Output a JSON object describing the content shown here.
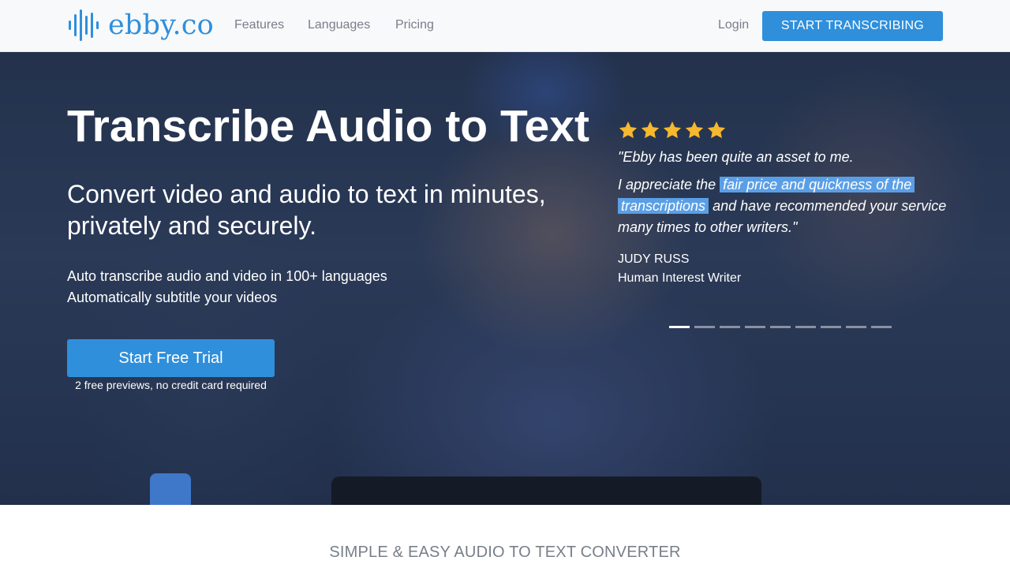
{
  "nav": {
    "logo_text": "ebby.co",
    "links": [
      "Features",
      "Languages",
      "Pricing"
    ],
    "login": "Login",
    "cta": "START TRANSCRIBING"
  },
  "hero": {
    "title": "Transcribe Audio to Text",
    "subtitle": "Convert video and audio to text in minutes, privately and securely.",
    "features": [
      "Auto transcribe audio and video in 100+ languages",
      "Automatically subtitle your videos"
    ],
    "cta": "Start Free Trial",
    "cta_note": "2 free previews, no credit card required"
  },
  "testimonial": {
    "rating": 5,
    "quote": {
      "line1": "\"Ebby has been quite an asset to me.",
      "line2_pre": "I appreciate the",
      "line2_highlight": "fair price and quickness of the",
      "line3_highlight": "transcriptions",
      "line3_post": "and have recommended your service",
      "line4": "many times to other writers.\""
    },
    "author": "JUDY RUSS",
    "role": "Human Interest Writer",
    "carousel_count": 9,
    "carousel_active": 1
  },
  "section": {
    "heading": "SIMPLE & EASY AUDIO TO TEXT CONVERTER"
  },
  "colors": {
    "brand": "#2f8fdb",
    "highlight": "#5a9fe6",
    "star": "#f5b82e",
    "nav_text": "#777f88"
  }
}
